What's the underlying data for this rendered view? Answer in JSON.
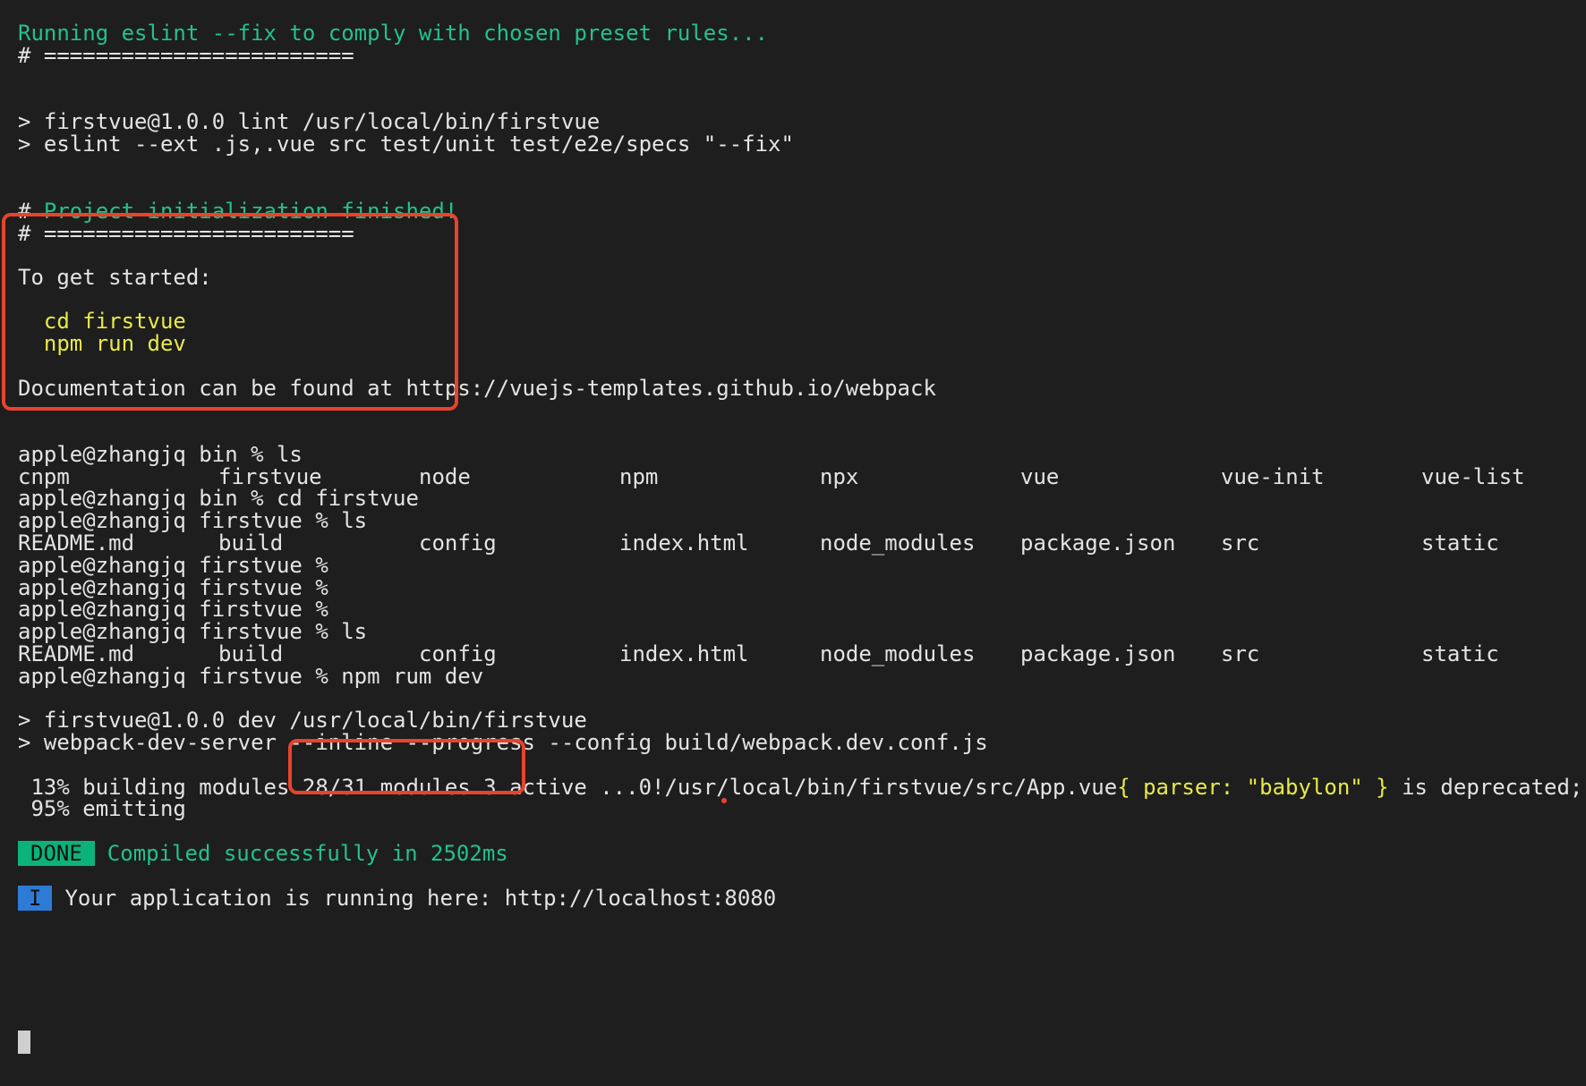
{
  "lines": {
    "l1": "Running eslint --fix to comply with chosen preset rules...",
    "l2": "# ========================",
    "l3": "> firstvue@1.0.0 lint /usr/local/bin/firstvue",
    "l4": "> eslint --ext .js,.vue src test/unit test/e2e/specs \"--fix\"",
    "l5_hash": "# ",
    "l5_text": "Project initialization finished!",
    "l6": "# ========================",
    "l7": "To get started:",
    "l8": "  cd firstvue",
    "l9": "  npm run dev",
    "l10": "Documentation can be found at https://vuejs-templates.github.io/webpack",
    "l11": "apple@zhangjq bin % ls",
    "l13": "apple@zhangjq bin % cd firstvue",
    "l14": "apple@zhangjq firstvue % ls",
    "l16": "apple@zhangjq firstvue %",
    "l17": "apple@zhangjq firstvue %",
    "l18": "apple@zhangjq firstvue %",
    "l19": "apple@zhangjq firstvue % ls",
    "l21": "apple@zhangjq firstvue % npm rum dev",
    "l22": "> firstvue@1.0.0 dev /usr/local/bin/firstvue",
    "l23": "> webpack-dev-server --inline --progress --config build/webpack.dev.conf.js",
    "l24_a": " 13% building modules 28/31 modules 3 active ...0!/usr/local/bin/firstvue/src/App.vue",
    "l24_b": "{ parser: \"babylon\" }",
    "l24_c": " is deprecated; we",
    "l25": " 95% emitting",
    "done_badge": "DONE",
    "done_text": "Compiled successfully in 2502ms",
    "info_badge": "I",
    "info_text": "Your application is running here: http://localhost:8080"
  },
  "ls_bin": [
    "cnpm",
    "firstvue",
    "node",
    "npm",
    "npx",
    "vue",
    "vue-init",
    "vue-list"
  ],
  "ls_firstvue": [
    "README.md",
    "build",
    "config",
    "index.html",
    "node_modules",
    "package.json",
    "src",
    "static"
  ],
  "colors": {
    "background": "#1e1e1e",
    "text": "#e4e4e4",
    "green": "#22c28a",
    "yellow": "#e9e94a",
    "done_badge": "#0bb37a",
    "info_badge": "#2e7bd6",
    "highlight_box": "#e8432d"
  }
}
